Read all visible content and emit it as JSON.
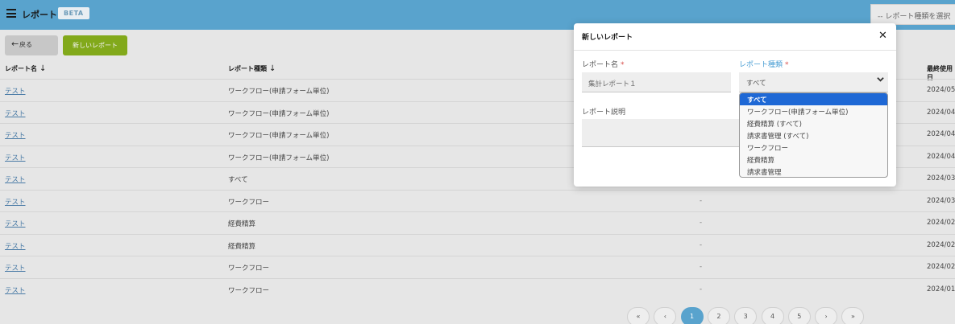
{
  "header": {
    "title": "レポート",
    "badge": "BETA",
    "select_placeholder": "-- レポート種類を選択"
  },
  "toolbar": {
    "back_label": "戻る",
    "new_label": "新しいレポート"
  },
  "table": {
    "columns": [
      "レポート名",
      "レポート種類",
      "最終使用日"
    ],
    "rows": [
      {
        "name": "テスト",
        "type": "ワークフロー(申請フォーム単位)",
        "desc": "",
        "date": "2024/05"
      },
      {
        "name": "テスト",
        "type": "ワークフロー(申請フォーム単位)",
        "desc": "",
        "date": "2024/04"
      },
      {
        "name": "テスト",
        "type": "ワークフロー(申請フォーム単位)",
        "desc": "",
        "date": "2024/04"
      },
      {
        "name": "テスト",
        "type": "ワークフロー(申請フォーム単位)",
        "desc": "",
        "date": "2024/04"
      },
      {
        "name": "テスト",
        "type": "すべて",
        "desc": "",
        "date": "2024/03"
      },
      {
        "name": "テスト",
        "type": "ワークフロー",
        "desc": "-",
        "date": "2024/03"
      },
      {
        "name": "テスト",
        "type": "経費精算",
        "desc": "-",
        "date": "2024/02"
      },
      {
        "name": "テスト",
        "type": "経費精算",
        "desc": "-",
        "date": "2024/02"
      },
      {
        "name": "テスト",
        "type": "ワークフロー",
        "desc": "-",
        "date": "2024/02"
      },
      {
        "name": "テスト",
        "type": "ワークフロー",
        "desc": "-",
        "date": "2024/01"
      }
    ]
  },
  "pagination": [
    "«",
    "‹",
    "1",
    "2",
    "3",
    "4",
    "5",
    "›",
    "»"
  ],
  "modal": {
    "title": "新しいレポート",
    "close": "✕",
    "name_label": "レポート名",
    "required_mark": "*",
    "name_value": "集計レポート１",
    "type_label": "レポート種類",
    "type_value": "すべて",
    "desc_label": "レポート説明",
    "desc_value": ""
  },
  "dropdown": {
    "options": [
      "すべて",
      "ワークフロー(申請フォーム単位)",
      "経費精算 (すべて)",
      "請求書管理 (すべて)",
      "ワークフロー",
      "経費精算",
      "請求書管理"
    ],
    "selected_index": 0
  },
  "colors": {
    "header": "#59a3cd",
    "new_button": "#82a91b",
    "selected_option": "#1e68d5",
    "link": "#4a7ba6"
  }
}
